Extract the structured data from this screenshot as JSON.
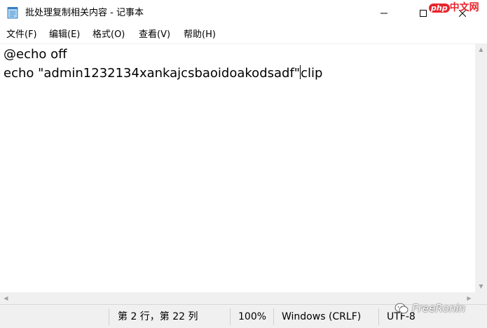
{
  "window": {
    "title": "批处理复制相关内容 - 记事本",
    "icon": "notepad-icon"
  },
  "watermark_top": {
    "badge": "php",
    "text": "中文网"
  },
  "menu": {
    "items": [
      {
        "label": "文件(F)"
      },
      {
        "label": "编辑(E)"
      },
      {
        "label": "格式(O)"
      },
      {
        "label": "查看(V)"
      },
      {
        "label": "帮助(H)"
      }
    ]
  },
  "editor": {
    "lines": [
      "@echo off",
      "echo \"admin1232134xankajcsbaoidoakodsadf\"",
      "clip"
    ]
  },
  "statusbar": {
    "position": "第 2 行，第 22 列",
    "zoom": "100%",
    "line_ending": "Windows (CRLF)",
    "encoding": "UTF-8"
  },
  "watermark_bottom": {
    "text": "FreeRonin"
  }
}
